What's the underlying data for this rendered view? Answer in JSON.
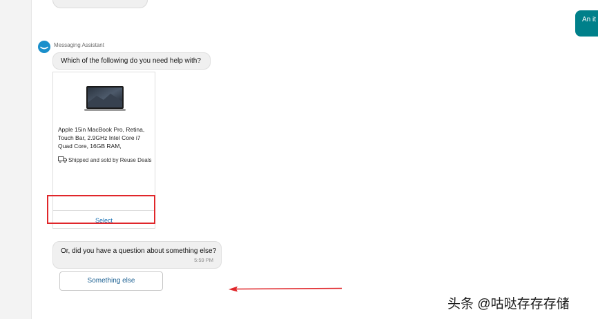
{
  "conversation": {
    "user_message_partial": "An it",
    "sender_name": "Messaging Assistant",
    "question_1": "Which of the following do you need help with?",
    "question_2": "Or, did you have a question about something else?",
    "timestamp": "5:59 PM"
  },
  "product_card": {
    "title": "Apple 15in MacBook Pro, Retina, Touch Bar, 2.9GHz Intel Core i7 Quad Core, 16GB RAM,",
    "shipping": "Shipped and sold by Reuse Deals",
    "select_label": "Select",
    "image_icon": "laptop-image"
  },
  "actions": {
    "something_else_label": "Something else"
  },
  "annotations": {
    "highlight_color": "#e0262a",
    "arrow_color": "#e0262a"
  },
  "watermark": {
    "text": "头条 @咕哒存存存储"
  },
  "colors": {
    "accent_teal": "#00808a",
    "avatar_blue": "#1a8fcb",
    "link_blue": "#1a73b5"
  }
}
